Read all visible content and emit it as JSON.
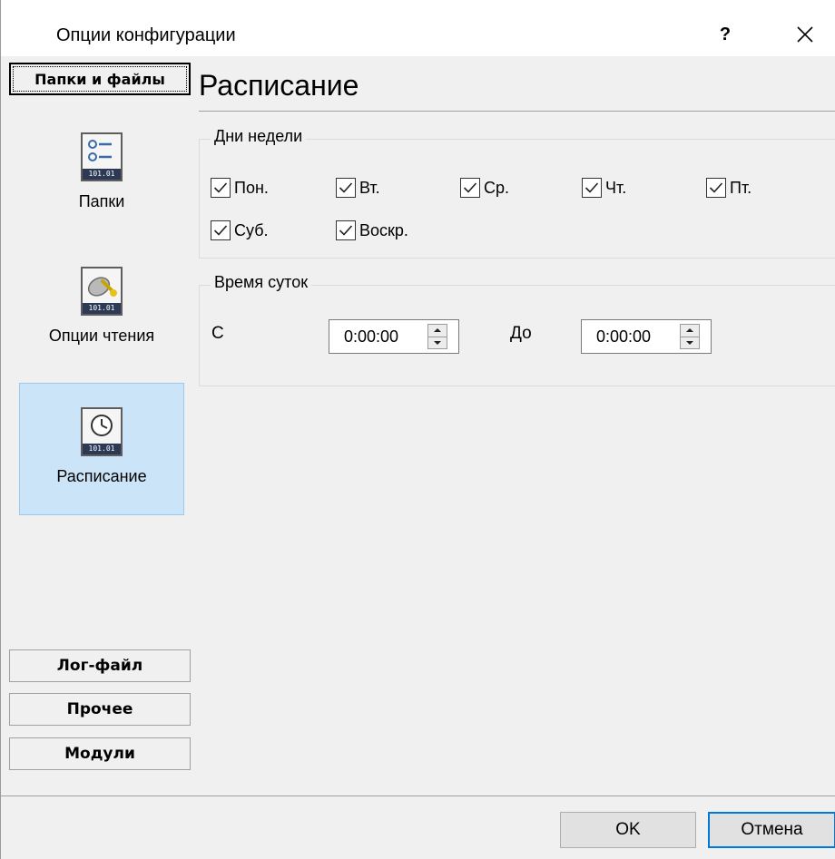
{
  "window": {
    "title": "Опции конфигурации",
    "help_label": "?"
  },
  "nav": {
    "active_group": "Папки и файлы",
    "items": [
      {
        "label": "Папки",
        "icon": "folders-list-icon",
        "icon_strip": "101.01"
      },
      {
        "label": "Опции чтения",
        "icon": "satellite-dish-icon",
        "icon_strip": "101.01"
      },
      {
        "label": "Расписание",
        "icon": "clock-icon",
        "icon_strip": "101.01",
        "selected": true
      }
    ],
    "groups": [
      "Лог-файл",
      "Прочее",
      "Модули"
    ]
  },
  "main": {
    "heading": "Расписание",
    "days_group": {
      "legend": "Дни недели",
      "days": [
        {
          "label": "Пон.",
          "checked": true
        },
        {
          "label": "Вт.",
          "checked": true
        },
        {
          "label": "Ср.",
          "checked": true
        },
        {
          "label": "Чт.",
          "checked": true
        },
        {
          "label": "Пт.",
          "checked": true
        },
        {
          "label": "Суб.",
          "checked": true
        },
        {
          "label": "Воскр.",
          "checked": true
        }
      ]
    },
    "time_group": {
      "legend": "Время суток",
      "from_label": "С",
      "from_value": "0:00:00",
      "to_label": "До",
      "to_value": "0:00:00"
    }
  },
  "footer": {
    "ok_label": "OK",
    "cancel_label": "Отмена"
  },
  "colors": {
    "selection_bg": "#cce4f7",
    "selection_border": "#99c9ef",
    "default_button_border": "#0078d7"
  }
}
